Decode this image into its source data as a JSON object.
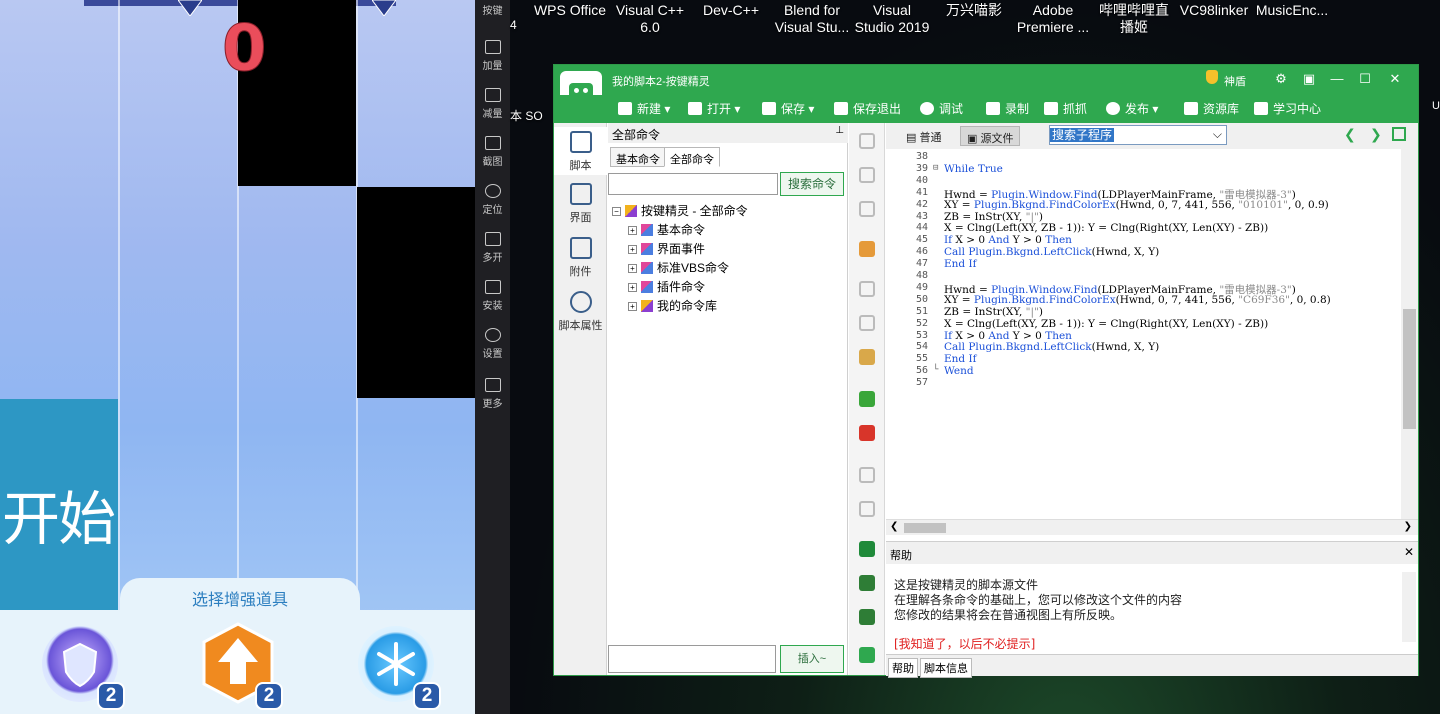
{
  "game": {
    "score": "0",
    "start_label": "开始",
    "tools_title": "选择增强道具",
    "tools": [
      {
        "name": "shield",
        "count": "2"
      },
      {
        "name": "arrow-boost",
        "count": "2"
      },
      {
        "name": "snowflake",
        "count": "2"
      }
    ]
  },
  "side_toolbar": {
    "items": [
      "按键",
      "加量",
      "减量",
      "截图",
      "定位",
      "多开",
      "安装",
      "设置",
      "更多"
    ]
  },
  "desktop": {
    "icons": [
      "WPS Office",
      "Visual C++ 6.0",
      "Dev-C++",
      "Blend for Visual Stu...",
      "Visual Studio 2019",
      "万兴喵影",
      "Adobe Premiere ...",
      "哔哩哔哩直播姬",
      "VC98linker",
      "MusicEnc..."
    ],
    "partial_labels": [
      "4",
      "本 SO"
    ]
  },
  "app": {
    "title": "我的脚本2-按键精灵",
    "shield_label": "神盾",
    "toolbar": [
      "新建",
      "打开",
      "保存",
      "保存退出",
      "调试",
      "录制",
      "抓抓",
      "发布",
      "资源库",
      "学习中心"
    ],
    "nav": [
      "脚本",
      "界面",
      "附件",
      "脚本属性"
    ],
    "cmd_panel": {
      "header": "全部命令",
      "tabs": [
        "基本命令",
        "全部命令"
      ],
      "search_button": "搜索命令",
      "insert_button": "插入~",
      "root": "按键精灵 - 全部命令",
      "children": [
        "基本命令",
        "界面事件",
        "标准VBS命令",
        "插件命令",
        "我的命令库"
      ]
    },
    "editor": {
      "view_normal": "普通",
      "view_source": "源文件",
      "sub_select": "搜索子程序",
      "first_line": 38,
      "lines": [
        "",
        "While True",
        "",
        "Hwnd = Plugin.Window.Find(LDPlayerMainFrame, \"雷电模拟器-3\")",
        "XY = Plugin.Bkgnd.FindColorEx(Hwnd, 0, 7, 441, 556, \"010101\", 0, 0.9)",
        "ZB = InStr(XY, \"|\")",
        "X = Clng(Left(XY, ZB - 1)): Y = Clng(Right(XY, Len(XY) - ZB))",
        "If X > 0 And Y > 0 Then",
        "Call Plugin.Bkgnd.LeftClick(Hwnd, X, Y)",
        "End If",
        "",
        "Hwnd = Plugin.Window.Find(LDPlayerMainFrame, \"雷电模拟器-3\")",
        "XY = Plugin.Bkgnd.FindColorEx(Hwnd, 0, 7, 441, 556, \"C69F36\", 0, 0.8)",
        "ZB = InStr(XY, \"|\")",
        "X = Clng(Left(XY, ZB - 1)): Y = Clng(Right(XY, Len(XY) - ZB))",
        "If X > 0 And Y > 0 Then",
        "Call Plugin.Bkgnd.LeftClick(Hwnd, X, Y)",
        "End If",
        "Wend",
        ""
      ]
    },
    "help": {
      "title": "帮助",
      "lines": [
        "这是按键精灵的脚本源文件",
        "在理解各条命令的基础上，您可以修改这个文件的内容",
        "您修改的结果将会在普通视图上有所反映。"
      ],
      "link": "[我知道了，以后不必提示]",
      "tabs": [
        "帮助",
        "脚本信息"
      ]
    }
  },
  "colors": {
    "app_green": "#2fa84f",
    "keyword_blue": "#1a4fd8",
    "start_tile": "#2d97c4",
    "score_red": "#ea4d5b"
  }
}
